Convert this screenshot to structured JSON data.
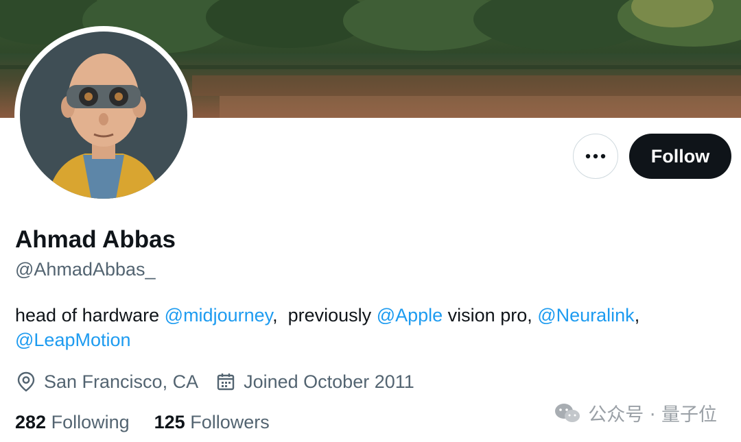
{
  "profile": {
    "display_name": "Ahmad Abbas",
    "handle": "@AhmadAbbas_",
    "bio": {
      "part1": "head of hardware ",
      "mention1": "@midjourney",
      "part2": ",  previously ",
      "mention2": "@Apple",
      "part3": " vision pro, ",
      "mention3": "@Neuralink",
      "part4": ",",
      "mention4": "@LeapMotion"
    },
    "location": "San Francisco, CA",
    "joined": "Joined October 2011"
  },
  "stats": {
    "following_count": "282",
    "following_label": "Following",
    "followers_count": "125",
    "followers_label": "Followers"
  },
  "actions": {
    "more_label": "···",
    "follow_label": "Follow"
  },
  "watermark": {
    "text": "公众号 · 量子位"
  },
  "icons": {
    "location": "location-pin-icon",
    "calendar": "calendar-icon",
    "more": "more-icon"
  },
  "colors": {
    "text_primary": "#0f1419",
    "text_secondary": "#536471",
    "link": "#1d9bf0",
    "follow_button_bg": "#0f1419"
  }
}
